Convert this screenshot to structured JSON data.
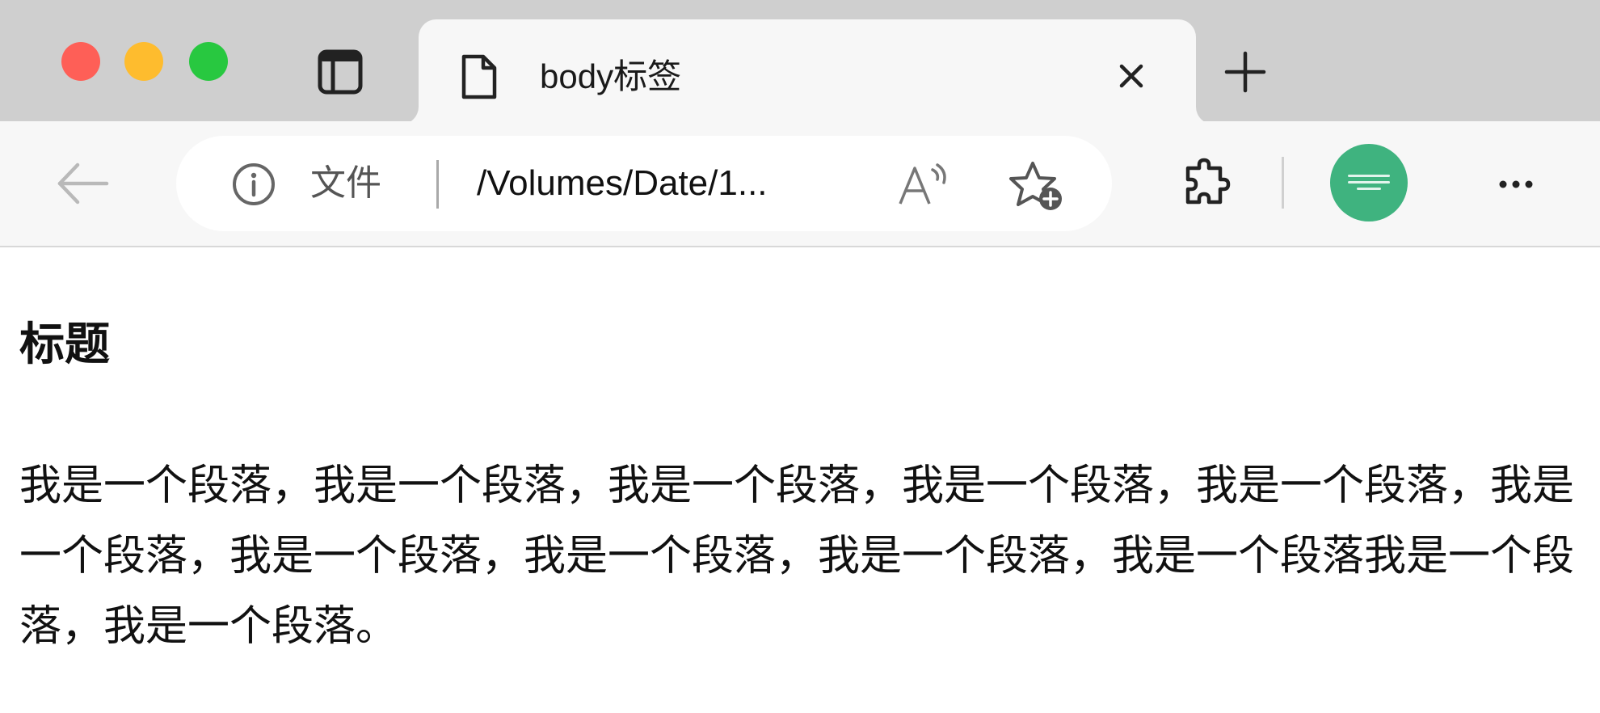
{
  "window": {
    "traffic_lights": [
      "close",
      "minimize",
      "maximize"
    ]
  },
  "tabs": [
    {
      "title": "body标签",
      "icon": "document-icon",
      "active": true
    }
  ],
  "toolbar": {
    "scheme_label": "文件",
    "url": "/Volumes/Date/1...",
    "icons": [
      "back-arrow-icon",
      "info-icon",
      "read-aloud-icon",
      "add-favorite-icon",
      "extensions-icon",
      "profile-avatar",
      "more-icon"
    ]
  },
  "page": {
    "heading": "标题",
    "paragraph": "我是一个段落，我是一个段落，我是一个段落，我是一个段落，我是一个段落，我是一个段落，我是一个段落，我是一个段落，我是一个段落，我是一个段落我是一个段落，我是一个段落。"
  },
  "colors": {
    "tabstrip_bg": "#cfcfcf",
    "toolbar_bg": "#f7f7f7",
    "avatar_bg": "#3fb37f",
    "close_light": "#fe5f57",
    "minimize_light": "#febc2e",
    "maximize_light": "#28c840"
  }
}
